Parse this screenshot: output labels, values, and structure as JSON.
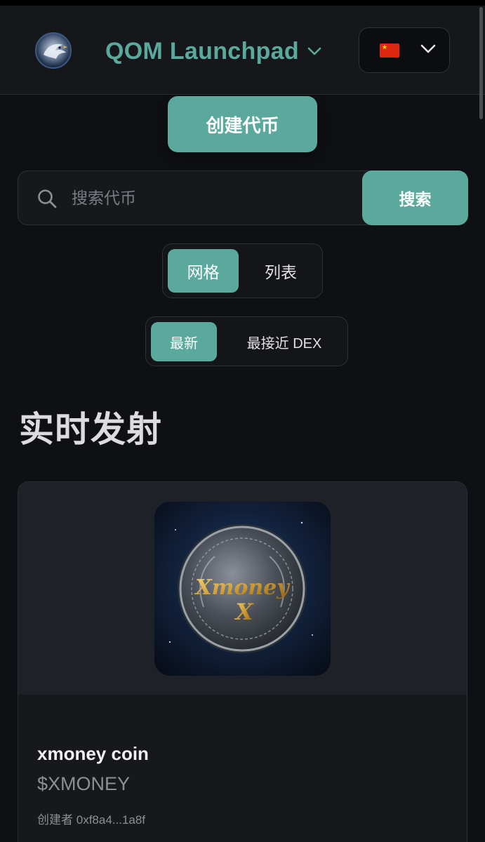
{
  "header": {
    "app_title": "QOM Launchpad",
    "logo_icon": "eagle-logo-icon",
    "title_chevron_icon": "chevron-down-icon",
    "language": {
      "flag": "china-flag-icon",
      "chevron_icon": "chevron-down-icon"
    }
  },
  "actions": {
    "create_label": "创建代币"
  },
  "search": {
    "placeholder": "搜索代币",
    "value": "",
    "button_label": "搜索",
    "icon": "search-icon"
  },
  "view_toggle": {
    "options": [
      "网格",
      "列表"
    ],
    "active": "网格"
  },
  "sort_toggle": {
    "options": [
      "最新",
      "最接近 DEX"
    ],
    "active": "最新"
  },
  "section": {
    "title": "实时发射"
  },
  "tokens": [
    {
      "name": "xmoney coin",
      "symbol": "$XMONEY",
      "creator_label": "创建者",
      "creator": "0xf8a4...1a8f",
      "coin_text_line1": "Xmoney",
      "coin_text_line2": "X"
    }
  ],
  "colors": {
    "accent": "#5aa99c",
    "background": "#0f1013",
    "surface": "#16181c",
    "muted_text": "#8c8f95"
  }
}
